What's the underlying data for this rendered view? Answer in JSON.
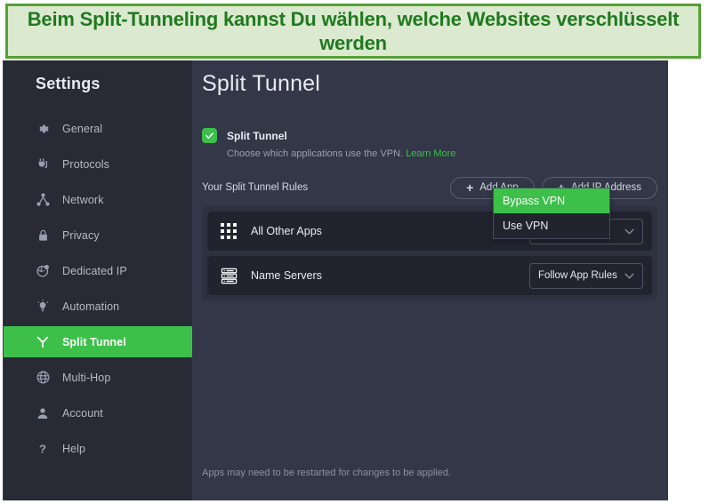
{
  "banner": {
    "text": "Beim Split-Tunneling kannst Du wählen, welche Websites verschlüsselt werden",
    "bg_color": "#dbe9cf",
    "border_color": "#55a034",
    "text_color": "#1f7a1f"
  },
  "sidebar": {
    "title": "Settings",
    "items": [
      {
        "label": "General",
        "icon": "gear-icon"
      },
      {
        "label": "Protocols",
        "icon": "plug-icon"
      },
      {
        "label": "Network",
        "icon": "network-nodes-icon"
      },
      {
        "label": "Privacy",
        "icon": "lock-icon"
      },
      {
        "label": "Dedicated IP",
        "icon": "globe-pin-icon"
      },
      {
        "label": "Automation",
        "icon": "lightbulb-icon"
      },
      {
        "label": "Split Tunnel",
        "icon": "split-tunnel-icon"
      },
      {
        "label": "Multi-Hop",
        "icon": "globe-icon"
      },
      {
        "label": "Account",
        "icon": "person-icon"
      },
      {
        "label": "Help",
        "icon": "question-mark-icon"
      }
    ],
    "active_index": 6
  },
  "main": {
    "page_title": "Split Tunnel",
    "toggle": {
      "label": "Split Tunnel",
      "checked": true,
      "description": "Choose which applications use the VPN.",
      "link_label": "Learn More"
    },
    "rules_title": "Your Split Tunnel Rules",
    "buttons": {
      "add_app": "Add App",
      "add_ip": "Add IP Address"
    },
    "rules": [
      {
        "label": "All Other Apps",
        "icon": "apps-grid-icon",
        "select_value": "Bypass VPN"
      },
      {
        "label": "Name Servers",
        "icon": "server-icon",
        "select_value": "Follow App Rules"
      }
    ],
    "dropdown": {
      "open": true,
      "options": [
        "Bypass VPN",
        "Use VPN"
      ],
      "selected": "Bypass VPN"
    },
    "footer_note": "Apps may need to be restarted for changes to be applied."
  },
  "colors": {
    "accent_green": "#3cc04a",
    "sidebar_bg": "#282a36",
    "content_bg": "#333747",
    "row_bg": "#21242f"
  }
}
